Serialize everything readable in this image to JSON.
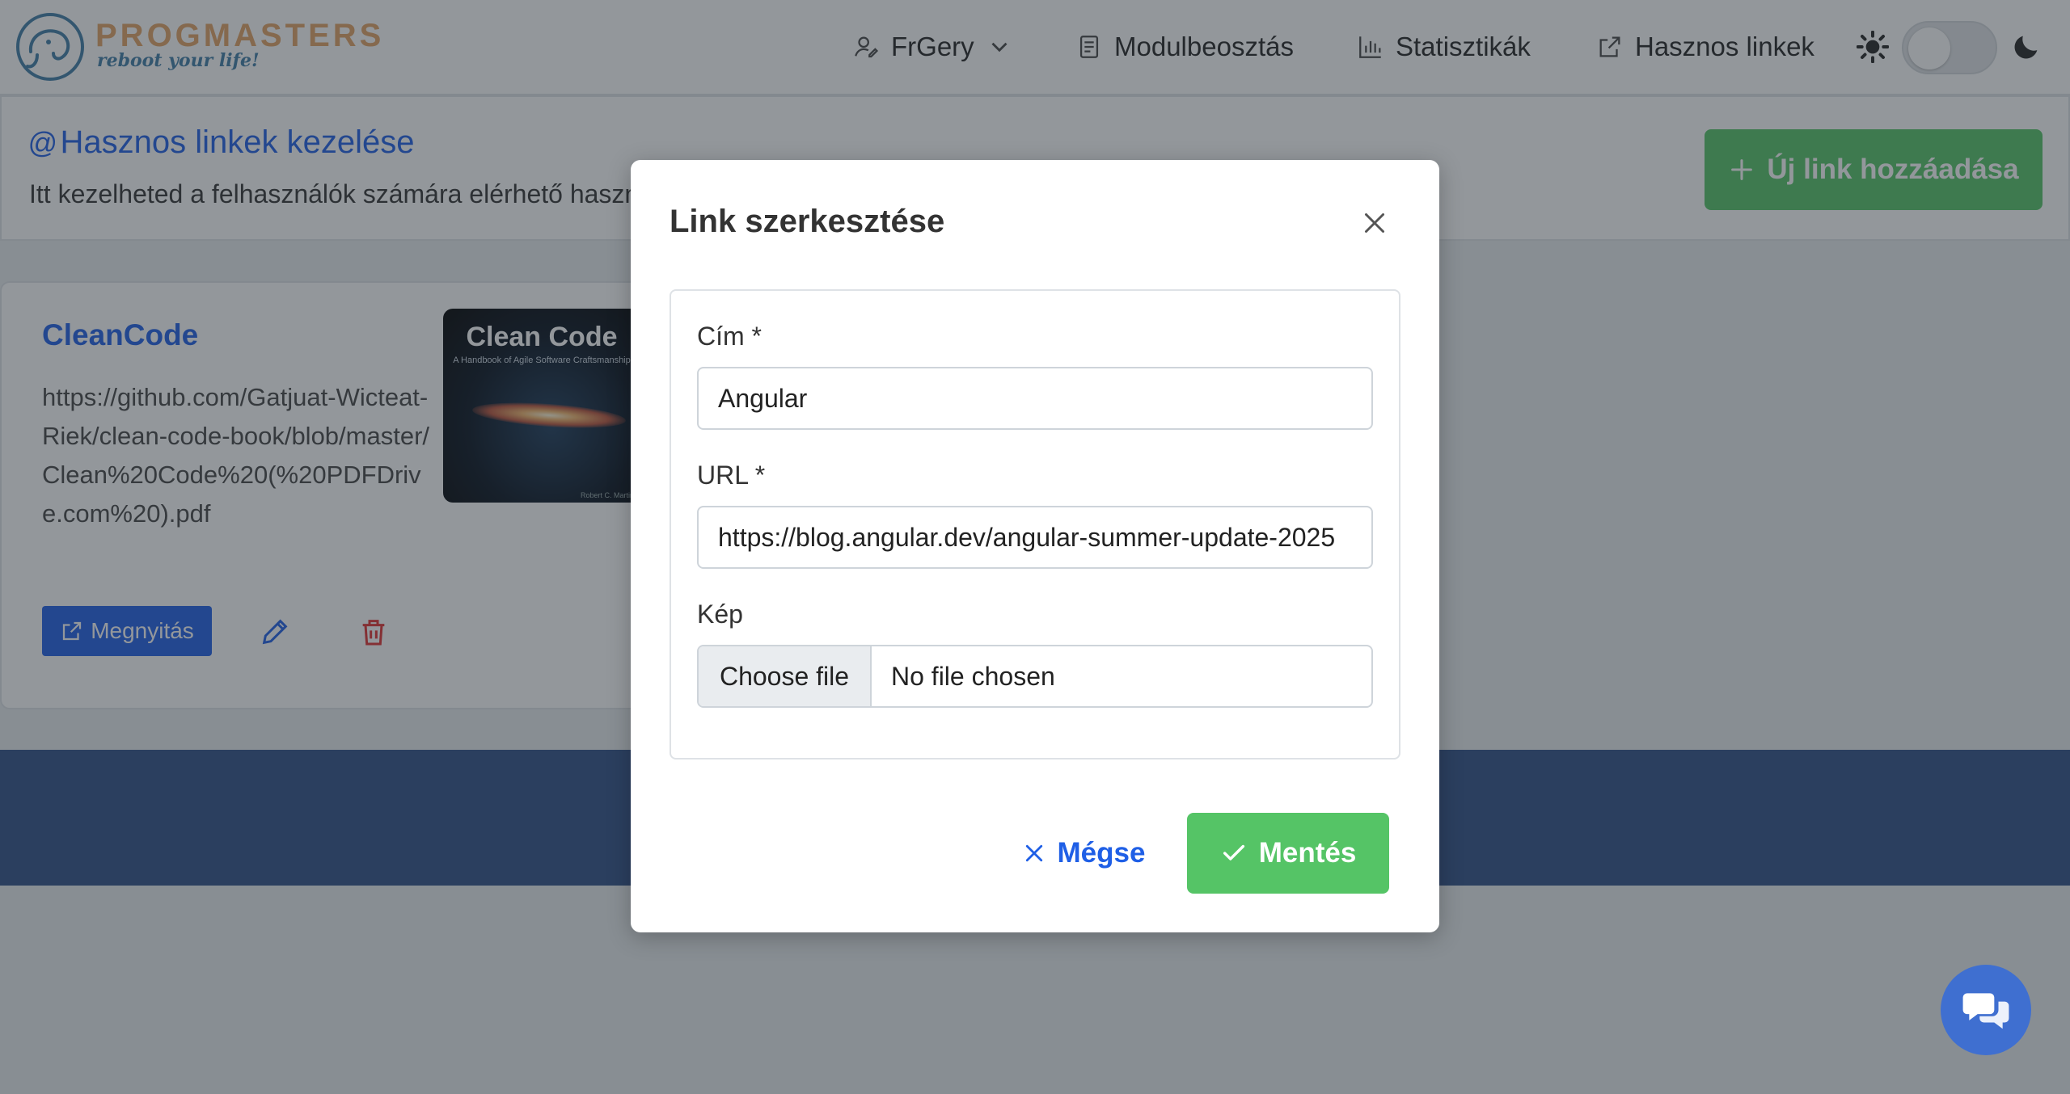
{
  "header": {
    "logo_name": "PROGMASTERS",
    "logo_tagline": "reboot your life!",
    "nav": {
      "user": "FrGery",
      "modules": "Modulbeosztás",
      "stats": "Statisztikák",
      "links": "Hasznos linkek"
    },
    "icons": [
      "user-icon",
      "chevron-down-icon",
      "document-icon",
      "bar-chart-icon",
      "external-link-icon",
      "sun-icon",
      "moon-icon"
    ],
    "theme_toggle_on": false
  },
  "page": {
    "title_prefix": "@",
    "title": "Hasznos linkek kezelése",
    "description": "Itt kezelheted a felhasználók számára elérhető hasznos linkeket.",
    "new_link_button": "Új link hozzáadása"
  },
  "links": [
    {
      "title": "CleanCode",
      "url": "https://github.com/Gatjuat-Wicteat-Riek/clean-code-book/blob/master/Clean%20Code%20(%20PDFDrive.com%20).pdf",
      "image": {
        "title": "Clean Code",
        "subtitle": "A Handbook of Agile Software Craftsmanship",
        "author": "Robert C. Martin"
      },
      "open_button": "Megnyitás"
    }
  ],
  "modal": {
    "title": "Link szerkesztése",
    "title_label": "Cím *",
    "title_value": "Angular",
    "url_label": "URL *",
    "url_value": "https://blog.angular.dev/angular-summer-update-2025",
    "image_label": "Kép",
    "file_button": "Choose file",
    "file_status": "No file chosen",
    "cancel_button": "Mégse",
    "save_button": "Mentés"
  },
  "colors": {
    "primary": "#1f5fe6",
    "success": "#55c466",
    "danger": "#e03131",
    "footer": "#2e4f86",
    "logo_orange": "#e2a365",
    "logo_blue": "#3f7ca7"
  }
}
